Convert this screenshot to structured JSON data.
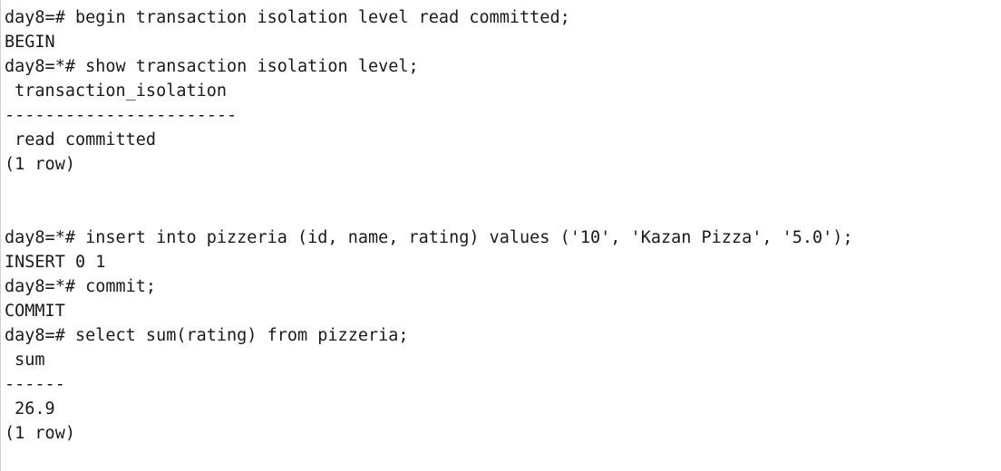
{
  "terminal": {
    "lines": [
      "day8=# begin transaction isolation level read committed;",
      "BEGIN",
      "day8=*# show transaction isolation level;",
      " transaction_isolation",
      "-----------------------",
      " read committed",
      "(1 row)",
      "",
      "",
      "day8=*# insert into pizzeria (id, name, rating) values ('10', 'Kazan Pizza', '5.0');",
      "INSERT 0 1",
      "day8=*# commit;",
      "COMMIT",
      "day8=# select sum(rating) from pizzeria;",
      " sum",
      "------",
      " 26.9",
      "(1 row)"
    ]
  }
}
